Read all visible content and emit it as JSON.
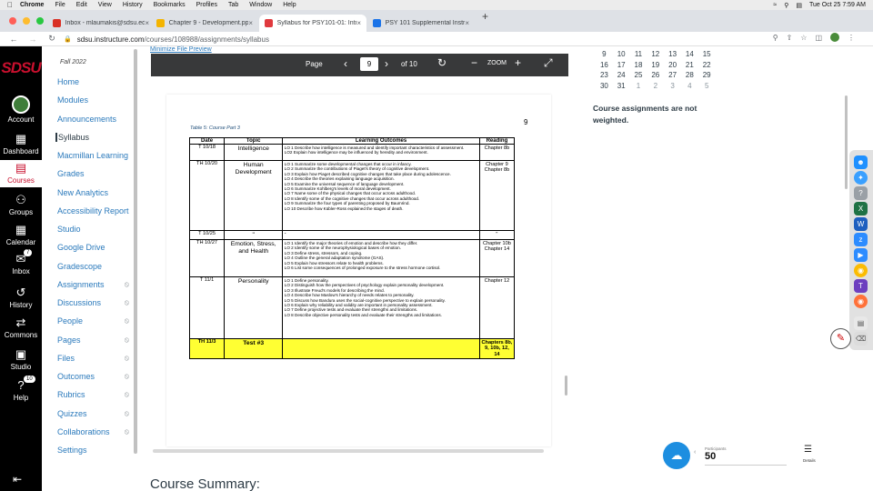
{
  "menubar": {
    "apple": "",
    "items": [
      "Chrome",
      "File",
      "Edit",
      "View",
      "History",
      "Bookmarks",
      "Profiles",
      "Tab",
      "Window",
      "Help"
    ],
    "datetime": "Tue Oct 25  7:59 AM"
  },
  "tabs": [
    {
      "label": "Inbox - mlaumakis@sdsu.edu",
      "favicon_color": "#d93025",
      "active": false
    },
    {
      "label": "Chapter 9 - Development.pptx",
      "favicon_color": "#f4b400",
      "active": false
    },
    {
      "label": "Syllabus for PSY101-01: Intro...",
      "favicon_color": "#e03a3e",
      "active": true
    },
    {
      "label": "PSY 101 Supplemental Instruct...",
      "favicon_color": "#1a73e8",
      "active": false
    }
  ],
  "address": {
    "domain": "sdsu.instructure.com",
    "path": "/courses/108988/assignments/syllabus"
  },
  "global_nav": {
    "logo": "SDSU",
    "items": [
      {
        "label": "Account"
      },
      {
        "label": "Dashboard"
      },
      {
        "label": "Courses"
      },
      {
        "label": "Groups"
      },
      {
        "label": "Calendar"
      },
      {
        "label": "Inbox",
        "badge": "7"
      },
      {
        "label": "History"
      },
      {
        "label": "Commons"
      },
      {
        "label": "Studio"
      },
      {
        "label": "Help",
        "badge": "10"
      }
    ]
  },
  "course_nav": {
    "term": "Fall 2022",
    "items": [
      {
        "label": "Home",
        "hidden": false
      },
      {
        "label": "Modules",
        "hidden": false
      },
      {
        "label": "Announcements",
        "hidden": false
      },
      {
        "label": "Syllabus",
        "hidden": false
      },
      {
        "label": "Macmillan Learning",
        "hidden": false
      },
      {
        "label": "Grades",
        "hidden": false
      },
      {
        "label": "New Analytics",
        "hidden": false
      },
      {
        "label": "Accessibility Report",
        "hidden": false
      },
      {
        "label": "Studio",
        "hidden": false
      },
      {
        "label": "Google Drive",
        "hidden": false
      },
      {
        "label": "Gradescope",
        "hidden": false
      },
      {
        "label": "Assignments",
        "hidden": true
      },
      {
        "label": "Discussions",
        "hidden": true
      },
      {
        "label": "People",
        "hidden": true
      },
      {
        "label": "Pages",
        "hidden": true
      },
      {
        "label": "Files",
        "hidden": true
      },
      {
        "label": "Outcomes",
        "hidden": true
      },
      {
        "label": "Rubrics",
        "hidden": true
      },
      {
        "label": "Quizzes",
        "hidden": true
      },
      {
        "label": "Collaborations",
        "hidden": true
      },
      {
        "label": "Settings",
        "hidden": false
      }
    ]
  },
  "main": {
    "file_preview_link": "Minimize File Preview",
    "pdf_toolbar": {
      "page_label": "Page",
      "current_page": "9",
      "of_label": "of 10",
      "zoom_label": "ZOOM"
    },
    "pdf": {
      "page_number": "9",
      "caption": "Table 5: Course Part 3",
      "headers": [
        "Date",
        "Topic",
        "Learning Outcomes",
        "Reading"
      ],
      "rows": [
        {
          "date": "T 10/18",
          "topic": "Intelligence",
          "outcomes": [
            "LO 1 Describe how intelligence is measured and identify important characteristics of assessment.",
            "LO2 Explain how intelligence may be influenced by heredity and environment."
          ],
          "reading": "Chapter 8b",
          "highlight": false
        },
        {
          "date": "TH 10/20",
          "topic": "Human Development",
          "outcomes": [
            "LO 1 Summarize some developmental changes that occur in infancy.",
            "LO 2 Summarize the contributions of Piaget's theory of cognitive development.",
            "LO 3 Explain how Piaget described cognitive changes that take place during adolescence.",
            "LO 4 Describe the theories explaining language acquisition.",
            "LO 5 Examine the universal sequence of language development.",
            "LO 6 Summarize Kohlberg's levels of moral development.",
            "LO 7 Name some of the physical changes that occur across adulthood.",
            "LO 8 Identify some of the cognitive changes that occur across adulthood.",
            "LO 9 Summarize the four types of parenting proposed by Baumrind.",
            "LO 10 Describe how Kübler-Ross explained the stages of death."
          ],
          "reading": "Chapter 9 Chapter 8b",
          "highlight": false
        },
        {
          "date": "T 10/25",
          "topic": "\"",
          "outcomes": [
            "\""
          ],
          "reading": "\"",
          "highlight": false
        },
        {
          "date": "TH 10/27",
          "topic": "Emotion, Stress, and Health",
          "outcomes": [
            "LO 1 Identify the major theories of emotion and describe how they differ.",
            "LO 2 Identify some of the neurophysiological bases of emotion.",
            "LO 3 Define stress, stressors, and coping.",
            "LO 4 Outline the general adaptation syndrome (GAS).",
            "LO 5 Explain how stressors relate to health problems.",
            "LO 6 List some consequences of prolonged exposure to the stress hormone cortisol."
          ],
          "reading": "Chapter 10b Chapter 14",
          "highlight": false
        },
        {
          "date": "T 11/1",
          "topic": "Personality",
          "outcomes": [
            "LO 1 Define personality.",
            "LO 2 Distinguish how the perspectives of psychology explain personality development.",
            "LO 3 Illustrate Freud's models for describing the mind.",
            "LO 4 Describe how Maslow's hierarchy of needs relates to personality.",
            "LO 5 Discuss how Bandura uses the social-cognitive perspective to explain personality.",
            "LO 6 Explain why reliability and validity are important in personality assessment.",
            "LO 7 Define projective tests and evaluate their strengths and limitations.",
            "LO 8 Describe objective personality tests and evaluate their strengths and limitations."
          ],
          "reading": "Chapter 12",
          "highlight": false
        },
        {
          "date": "TH 11/3",
          "topic": "Test #3",
          "outcomes": [
            ""
          ],
          "reading": "Chapters 8b, 9, 10b, 12, 14",
          "highlight": true
        }
      ]
    },
    "summary_heading": "Course Summary:"
  },
  "calendar": {
    "rows": [
      [
        {
          "d": "9"
        },
        {
          "d": "10"
        },
        {
          "d": "11"
        },
        {
          "d": "12"
        },
        {
          "d": "13"
        },
        {
          "d": "14"
        },
        {
          "d": "15"
        }
      ],
      [
        {
          "d": "16"
        },
        {
          "d": "17"
        },
        {
          "d": "18"
        },
        {
          "d": "19"
        },
        {
          "d": "20"
        },
        {
          "d": "21"
        },
        {
          "d": "22"
        }
      ],
      [
        {
          "d": "23"
        },
        {
          "d": "24"
        },
        {
          "d": "25"
        },
        {
          "d": "26"
        },
        {
          "d": "27"
        },
        {
          "d": "28"
        },
        {
          "d": "29"
        }
      ],
      [
        {
          "d": "30"
        },
        {
          "d": "31"
        },
        {
          "d": "1",
          "dim": true
        },
        {
          "d": "2",
          "dim": true
        },
        {
          "d": "3",
          "dim": true
        },
        {
          "d": "4",
          "dim": true
        },
        {
          "d": "5",
          "dim": true
        }
      ]
    ],
    "note": "Course assignments are not weighted."
  },
  "zoom_widget": {
    "participants_label": "Participants",
    "participants_count": "50",
    "details_label": "Details"
  },
  "colors": {
    "canvas_red": "#c8102e",
    "link_blue": "#2b7abc",
    "highlight_yellow": "#ffff33"
  }
}
